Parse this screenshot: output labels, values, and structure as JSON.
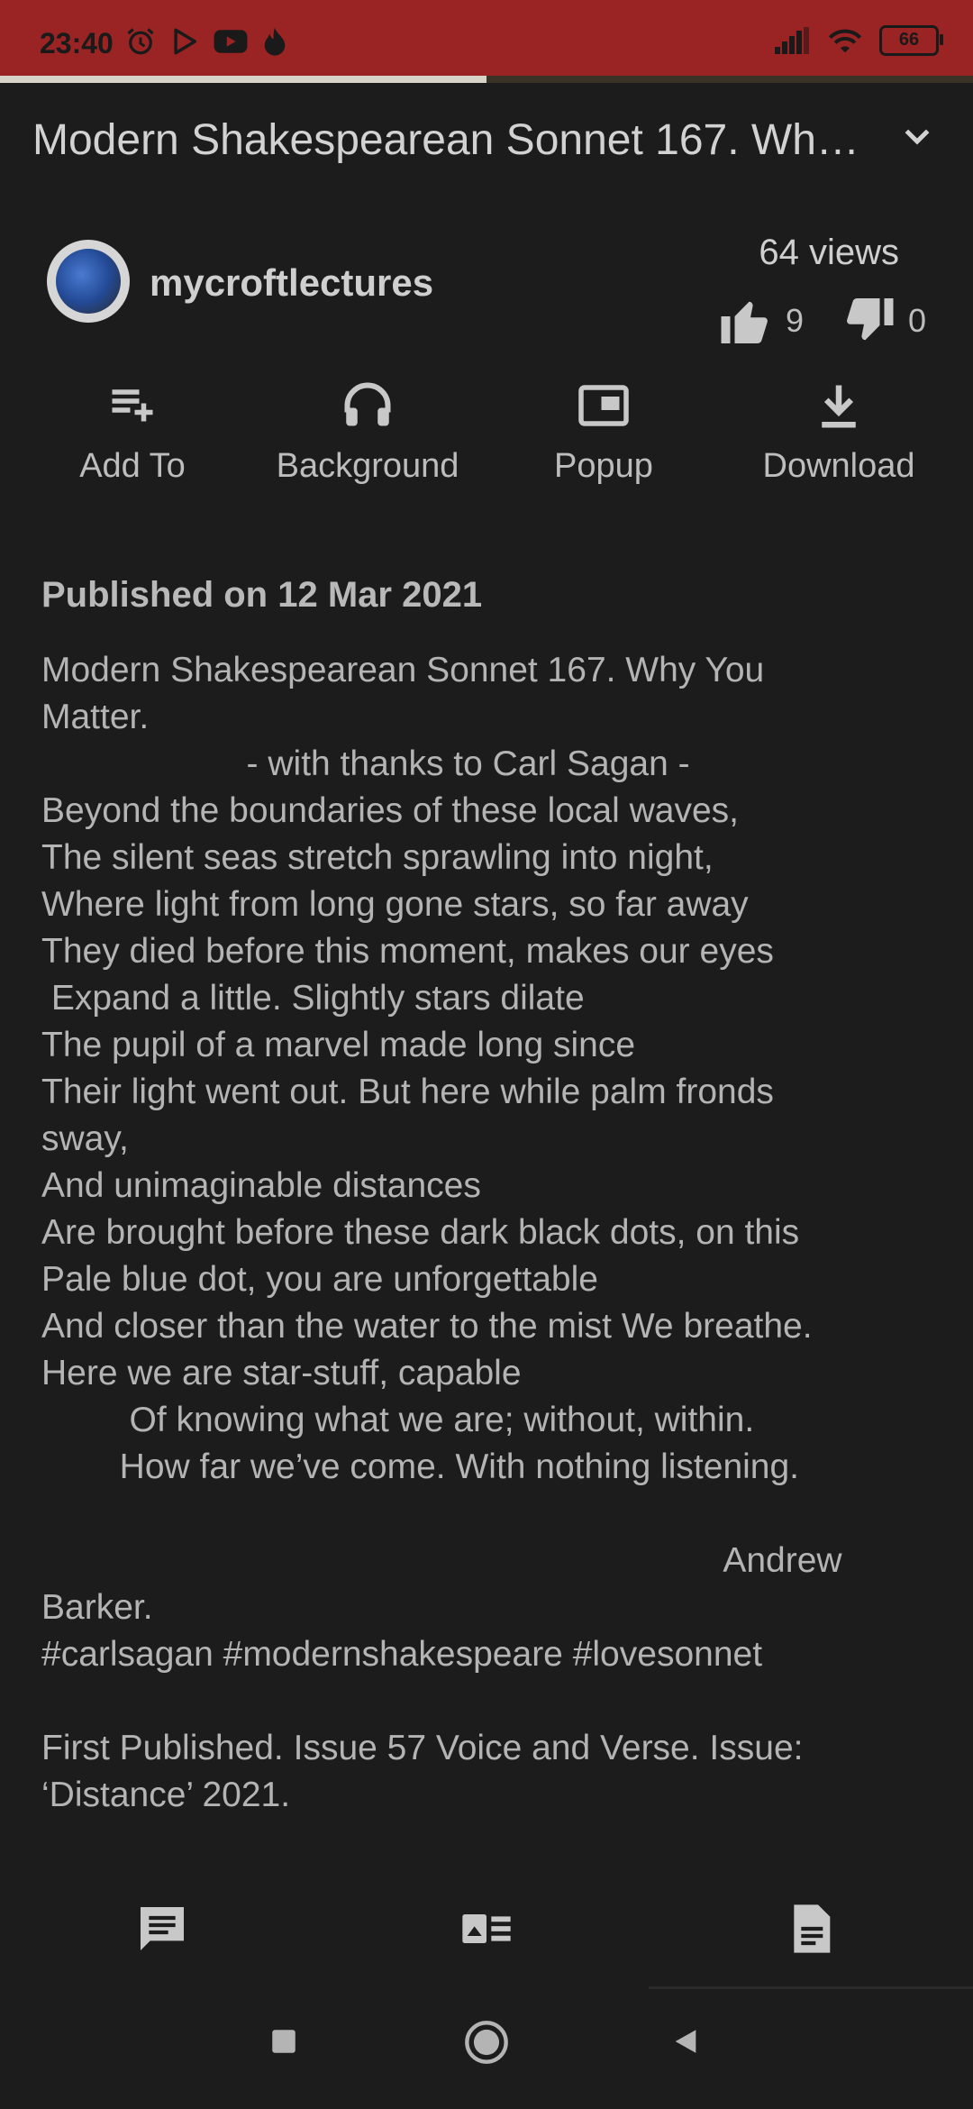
{
  "status_bar": {
    "time": "23:40",
    "battery": "66",
    "left_icons": [
      "alarm-icon",
      "play-store-icon",
      "youtube-icon",
      "flame-icon"
    ],
    "right_icons": [
      "signal-icon",
      "wifi-icon",
      "battery-icon"
    ],
    "background_color": "#9a2424"
  },
  "player": {
    "progress_fraction": 0.5
  },
  "video": {
    "title": "Modern Shakespearean Sonnet 167. Wh…",
    "channel": "mycroftlectures",
    "views": "64 views",
    "likes": "9",
    "dislikes": "0"
  },
  "actions": [
    {
      "label": "Add To",
      "icon": "playlist-add-icon"
    },
    {
      "label": "Background",
      "icon": "headphones-icon"
    },
    {
      "label": "Popup",
      "icon": "picture-in-picture-icon"
    },
    {
      "label": "Download",
      "icon": "download-icon"
    }
  ],
  "description": {
    "published": "Published on 12 Mar 2021",
    "lines": [
      "Modern Shakespearean Sonnet 167. Why You",
      "Matter.",
      "                     - with thanks to Carl Sagan -",
      "Beyond the boundaries of these local waves,",
      "The silent seas stretch sprawling into night,",
      "Where light from long gone stars, so far away",
      "They died before this moment, makes our eyes",
      " Expand a little. Slightly stars dilate",
      "The pupil of a marvel made long since",
      "Their light went out. But here while palm fronds",
      "sway,",
      "And unimaginable distances",
      "Are brought before these dark black dots, on this",
      "Pale blue dot, you are unforgettable",
      "And closer than the water to the mist We breathe.",
      "Here we are star-stuff, capable",
      "         Of knowing what we are; without, within.",
      "        How far we’ve come. With nothing listening.",
      "",
      "                                                                      Andrew",
      "Barker.",
      "#carlsagan #modernshakespeare #lovesonnet",
      "",
      "First Published. Issue 57 Voice and Verse. Issue:",
      "‘Distance’ 2021."
    ]
  },
  "tabs": [
    {
      "icon": "comments-icon"
    },
    {
      "icon": "related-videos-icon"
    },
    {
      "icon": "description-icon"
    }
  ],
  "nav": {
    "icons": [
      "recents-icon",
      "home-icon",
      "back-icon"
    ]
  },
  "colors": {
    "background": "#1c1c1c",
    "text": "#b4b4b4",
    "icon": "#c8c8c8"
  }
}
